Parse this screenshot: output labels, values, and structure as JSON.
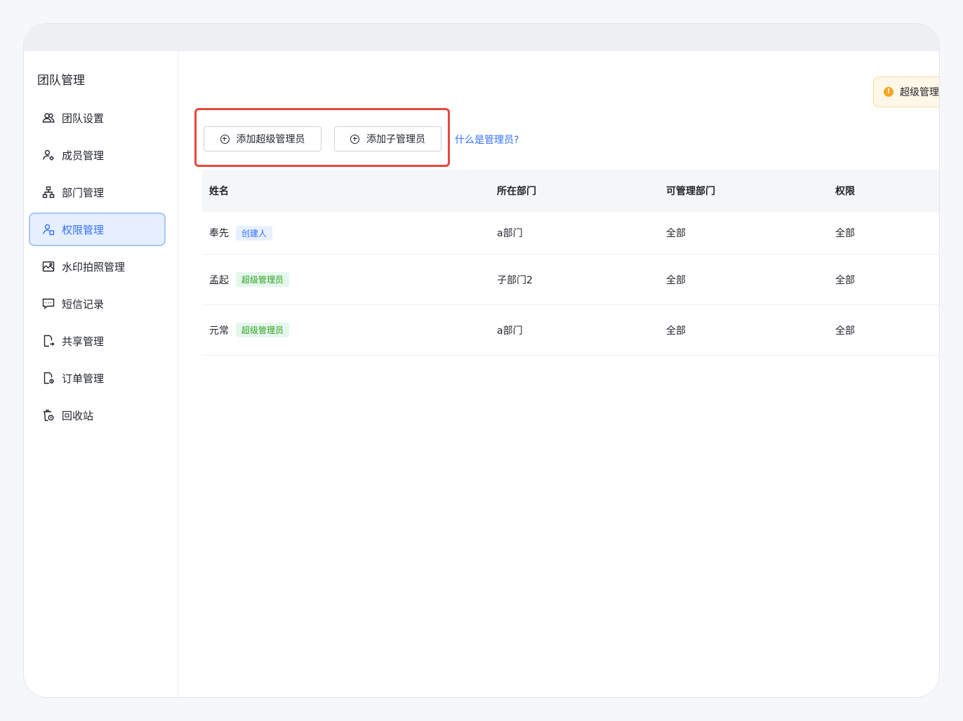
{
  "sidebar": {
    "title": "团队管理",
    "items": [
      {
        "label": "团队设置",
        "icon": "team-icon"
      },
      {
        "label": "成员管理",
        "icon": "member-icon"
      },
      {
        "label": "部门管理",
        "icon": "department-icon"
      },
      {
        "label": "权限管理",
        "icon": "permission-icon",
        "active": true
      },
      {
        "label": "水印拍照管理",
        "icon": "watermark-photo-icon"
      },
      {
        "label": "短信记录",
        "icon": "sms-icon"
      },
      {
        "label": "共享管理",
        "icon": "share-icon"
      },
      {
        "label": "订单管理",
        "icon": "order-icon"
      },
      {
        "label": "回收站",
        "icon": "recycle-bin-icon"
      }
    ]
  },
  "notice": {
    "text": "超级管理"
  },
  "toolbar": {
    "add_super_admin": "添加超级管理员",
    "add_sub_admin": "添加子管理员",
    "help_link": "什么是管理员?"
  },
  "table": {
    "headers": [
      "姓名",
      "所在部门",
      "可管理部门",
      "权限"
    ],
    "rows": [
      {
        "name": "奉先",
        "tag": "创建人",
        "dept": "a部门",
        "managed": "全部",
        "perm": "全部"
      },
      {
        "name": "孟起",
        "tag": "超级管理员",
        "dept": "子部门2",
        "managed": "全部",
        "perm": "全部"
      },
      {
        "name": "元常",
        "tag": "超级管理员",
        "dept": "a部门",
        "managed": "全部",
        "perm": "全部"
      }
    ]
  },
  "colors": {
    "accent": "#3370ff",
    "highlight": "#e8473c",
    "tag_green": "#2ea121",
    "warning": "#f5a623"
  }
}
